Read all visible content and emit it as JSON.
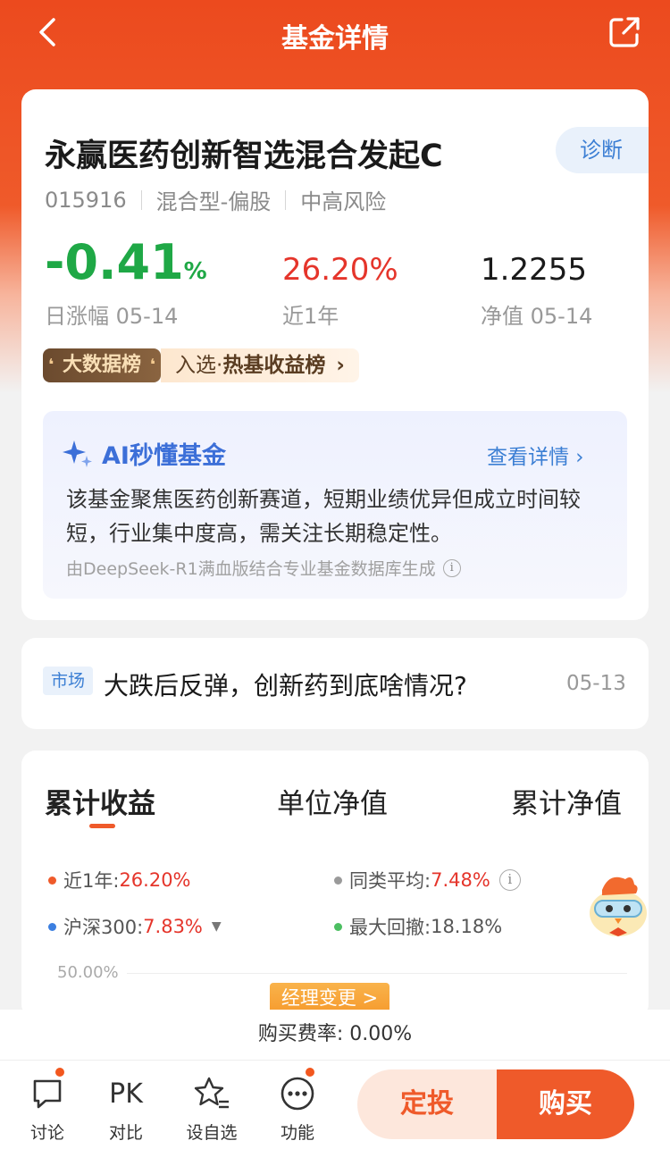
{
  "header": {
    "title": "基金详情",
    "back_icon": "chevron-left-icon",
    "share_icon": "share-icon"
  },
  "fund": {
    "name": "永赢医药创新智选混合发起C",
    "diagnose_label": "诊断",
    "code": "015916",
    "type": "混合型-偏股",
    "risk": "中高风险",
    "daily_change_value": "-0.41",
    "daily_change_pct": "%",
    "daily_change_label": "日涨幅 05-14",
    "one_year_return": "26.20%",
    "one_year_label": "近1年",
    "nav_value": "1.2255",
    "nav_label": "净值 05-14",
    "rank_badge": "大数据榜",
    "rank_text_prefix": "入选·",
    "rank_text_bold": "热基收益榜",
    "rank_chevron": "›",
    "colors": {
      "down": "#1fa846",
      "up": "#e5352b",
      "brand": "#ef5a2a"
    }
  },
  "ai": {
    "title": "AI秒懂基金",
    "more_label": "查看详情 ›",
    "description": "该基金聚焦医药创新赛道，短期业绩优异但成立时间较短，行业集中度高，需关注长期稳定性。",
    "source": "由DeepSeek-R1满血版结合专业基金数据库生成",
    "info_icon": "i"
  },
  "news": {
    "tag": "市场",
    "title": "大跌后反弹，创新药到底啥情况?",
    "date": "05-13"
  },
  "chart": {
    "tabs": [
      "累计收益",
      "单位净值",
      "累计净值"
    ],
    "active_tab": 0,
    "legend": {
      "one_year_label": "近1年:",
      "one_year_value": "26.20%",
      "peer_avg_label": "同类平均:",
      "peer_avg_value": "7.48%",
      "hs300_label": "沪深300:",
      "hs300_value": "7.83%",
      "max_drawdown_label": "最大回撤:",
      "max_drawdown_value": "18.18%"
    },
    "y_tick_top": "50.00%",
    "manager_change_label": "经理变更 >"
  },
  "fee": {
    "text": "购买费率: 0.00%"
  },
  "bottom_nav": {
    "items": [
      {
        "label": "讨论",
        "icon": "chat-bubble-icon"
      },
      {
        "label": "对比",
        "icon": "PK"
      },
      {
        "label": "设自选",
        "icon": "star-list-icon"
      },
      {
        "label": "功能",
        "icon": "more-dots-icon"
      }
    ],
    "invest_label": "定投",
    "buy_label": "购买"
  }
}
